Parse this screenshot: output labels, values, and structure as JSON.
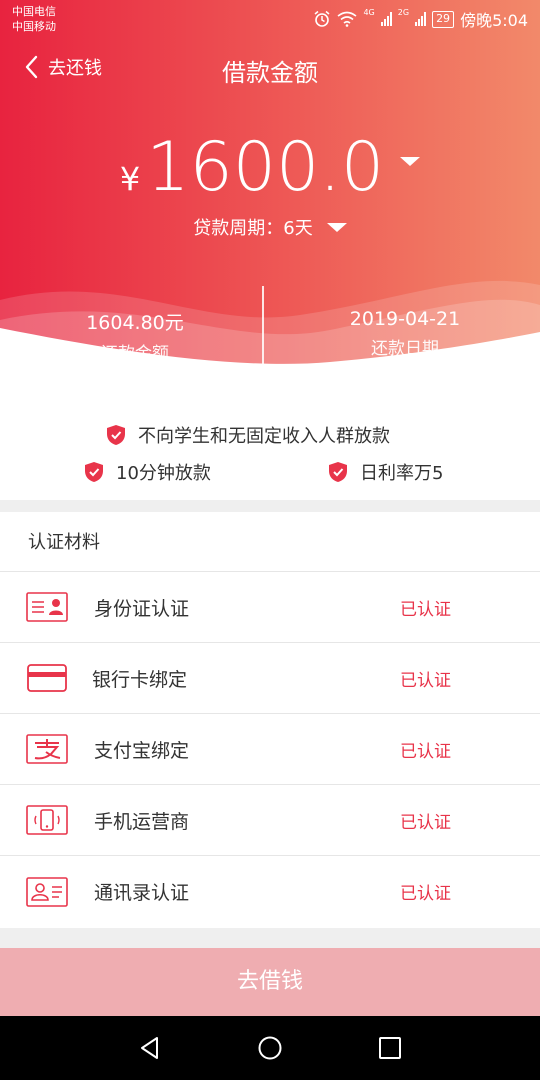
{
  "status": {
    "carrier1": "中国电信",
    "carrier2": "中国移动",
    "net1": "4G",
    "net2": "2G",
    "battery": "29",
    "time": "傍晚5:04"
  },
  "nav": {
    "back_label": "去还钱",
    "title": "借款金额"
  },
  "loan": {
    "currency": "¥",
    "amount": "1600.0",
    "period_label": "贷款周期：6天"
  },
  "summary": {
    "repay_amount_value": "1604.80元",
    "repay_amount_label": "还款金额",
    "repay_date_value": "2019-04-21",
    "repay_date_label": "还款日期"
  },
  "features": [
    "不向学生和无固定收入人群放款",
    "10分钟放款",
    "日利率万5"
  ],
  "cert": {
    "title": "认证材料",
    "items": [
      {
        "name": "身份证认证",
        "status": "已认证",
        "icon": "id-card-icon"
      },
      {
        "name": "银行卡绑定",
        "status": "已认证",
        "icon": "bank-card-icon"
      },
      {
        "name": "支付宝绑定",
        "status": "已认证",
        "icon": "alipay-icon"
      },
      {
        "name": "手机运营商",
        "status": "已认证",
        "icon": "phone-icon"
      },
      {
        "name": "通讯录认证",
        "status": "已认证",
        "icon": "contacts-icon"
      }
    ]
  },
  "action": {
    "borrow_label": "去借钱"
  },
  "colors": {
    "accent": "#e8344a",
    "button_disabled": "#efadb1"
  }
}
